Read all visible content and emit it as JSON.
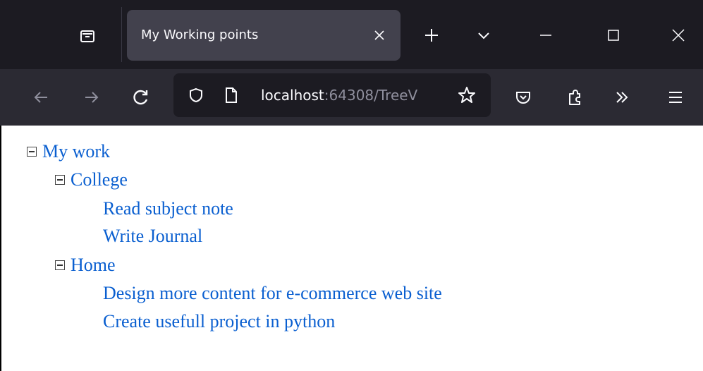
{
  "browser": {
    "tab": {
      "title": "My Working points"
    },
    "address": {
      "host": "localhost",
      "rest": ":64308/TreeV"
    }
  },
  "icons": {
    "tab_list": "tab-list-icon",
    "close_tab": "close-icon",
    "new_tab": "plus-icon",
    "list_all_tabs": "chevron-down-icon",
    "minimize": "minimize-icon",
    "maximize": "maximize-icon",
    "close_window": "close-icon",
    "back": "back-arrow-icon",
    "forward": "forward-arrow-icon",
    "reload": "reload-icon",
    "shield": "shield-icon",
    "page": "page-icon",
    "bookmark": "star-icon",
    "pocket": "pocket-icon",
    "extensions": "extensions-icon",
    "overflow": "double-chevron-icon",
    "menu": "hamburger-icon"
  },
  "tree": {
    "root": {
      "label": "My work",
      "children": [
        {
          "label": "College",
          "items": [
            "Read subject note",
            "Write Journal"
          ]
        },
        {
          "label": "Home",
          "items": [
            "Design more content for e-commerce web site",
            "Create usefull project in python"
          ]
        }
      ]
    }
  },
  "colors": {
    "link": "#0a5fd0",
    "tabstrip_bg": "#1c1b22",
    "navbar_bg": "#2b2a33",
    "active_tab_bg": "#42414d"
  }
}
